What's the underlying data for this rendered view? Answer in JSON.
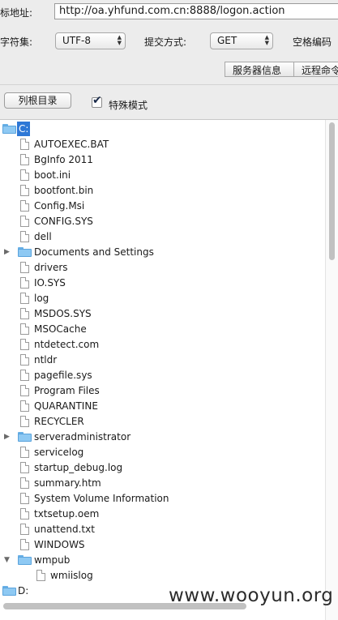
{
  "form": {
    "url_label": "标地址:",
    "url_value": "http://oa.yhfund.com.cn:8888/logon.action",
    "charset_label": "字符集:",
    "charset_value": "UTF-8",
    "method_label": "提交方式:",
    "method_value": "GET",
    "space_encoding_label": "空格编码"
  },
  "tabs": [
    {
      "label": "服务器信息"
    },
    {
      "label": "远程命令"
    }
  ],
  "toolbar": {
    "list_root_button": "列根目录",
    "special_mode_label": "特殊模式",
    "special_mode_checked": true
  },
  "tree": {
    "root_c": "C:",
    "items": [
      {
        "name": "AUTOEXEC.BAT",
        "type": "file"
      },
      {
        "name": "BgInfo 2011",
        "type": "file"
      },
      {
        "name": "boot.ini",
        "type": "file"
      },
      {
        "name": "bootfont.bin",
        "type": "file"
      },
      {
        "name": "Config.Msi",
        "type": "file"
      },
      {
        "name": "CONFIG.SYS",
        "type": "file"
      },
      {
        "name": "dell",
        "type": "file"
      },
      {
        "name": "Documents and Settings",
        "type": "folder"
      },
      {
        "name": "drivers",
        "type": "file"
      },
      {
        "name": "IO.SYS",
        "type": "file"
      },
      {
        "name": "log",
        "type": "file"
      },
      {
        "name": "MSDOS.SYS",
        "type": "file"
      },
      {
        "name": "MSOCache",
        "type": "file"
      },
      {
        "name": "ntdetect.com",
        "type": "file"
      },
      {
        "name": "ntldr",
        "type": "file"
      },
      {
        "name": "pagefile.sys",
        "type": "file"
      },
      {
        "name": "Program Files",
        "type": "file"
      },
      {
        "name": "QUARANTINE",
        "type": "file"
      },
      {
        "name": "RECYCLER",
        "type": "file"
      },
      {
        "name": "serveradministrator",
        "type": "folder"
      },
      {
        "name": "servicelog",
        "type": "file"
      },
      {
        "name": "startup_debug.log",
        "type": "file"
      },
      {
        "name": "summary.htm",
        "type": "file"
      },
      {
        "name": "System Volume Information",
        "type": "file"
      },
      {
        "name": "txtsetup.oem",
        "type": "file"
      },
      {
        "name": "unattend.txt",
        "type": "file"
      },
      {
        "name": "WINDOWS",
        "type": "file"
      }
    ],
    "wmpub": "wmpub",
    "wmiislog": "wmiislog",
    "root_d": "D:"
  },
  "watermark": "www.wooyun.org"
}
